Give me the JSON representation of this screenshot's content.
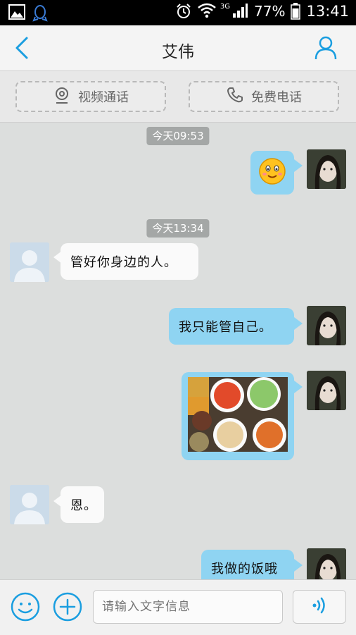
{
  "status_bar": {
    "network": "3G",
    "battery": "77%",
    "time": "13:41"
  },
  "header": {
    "title": "艾伟"
  },
  "call_actions": {
    "video": "视频通话",
    "phone": "免费电话"
  },
  "messages": [
    {
      "type": "timestamp",
      "text": "今天09:53"
    },
    {
      "type": "emoji",
      "from": "self"
    },
    {
      "type": "timestamp",
      "text": "今天13:34"
    },
    {
      "type": "text",
      "from": "other",
      "text": "管好你身边的人。"
    },
    {
      "type": "text",
      "from": "self",
      "text": "我只能管自己。"
    },
    {
      "type": "image",
      "from": "self"
    },
    {
      "type": "text",
      "from": "other",
      "text": "恩。"
    },
    {
      "type": "text",
      "from": "self",
      "text": "我做的饭哦"
    }
  ],
  "input": {
    "placeholder": "请输入文字信息"
  },
  "colors": {
    "accent": "#1a9ee0",
    "bubble_out": "#8fd4f2",
    "bubble_in": "#fafafa"
  }
}
